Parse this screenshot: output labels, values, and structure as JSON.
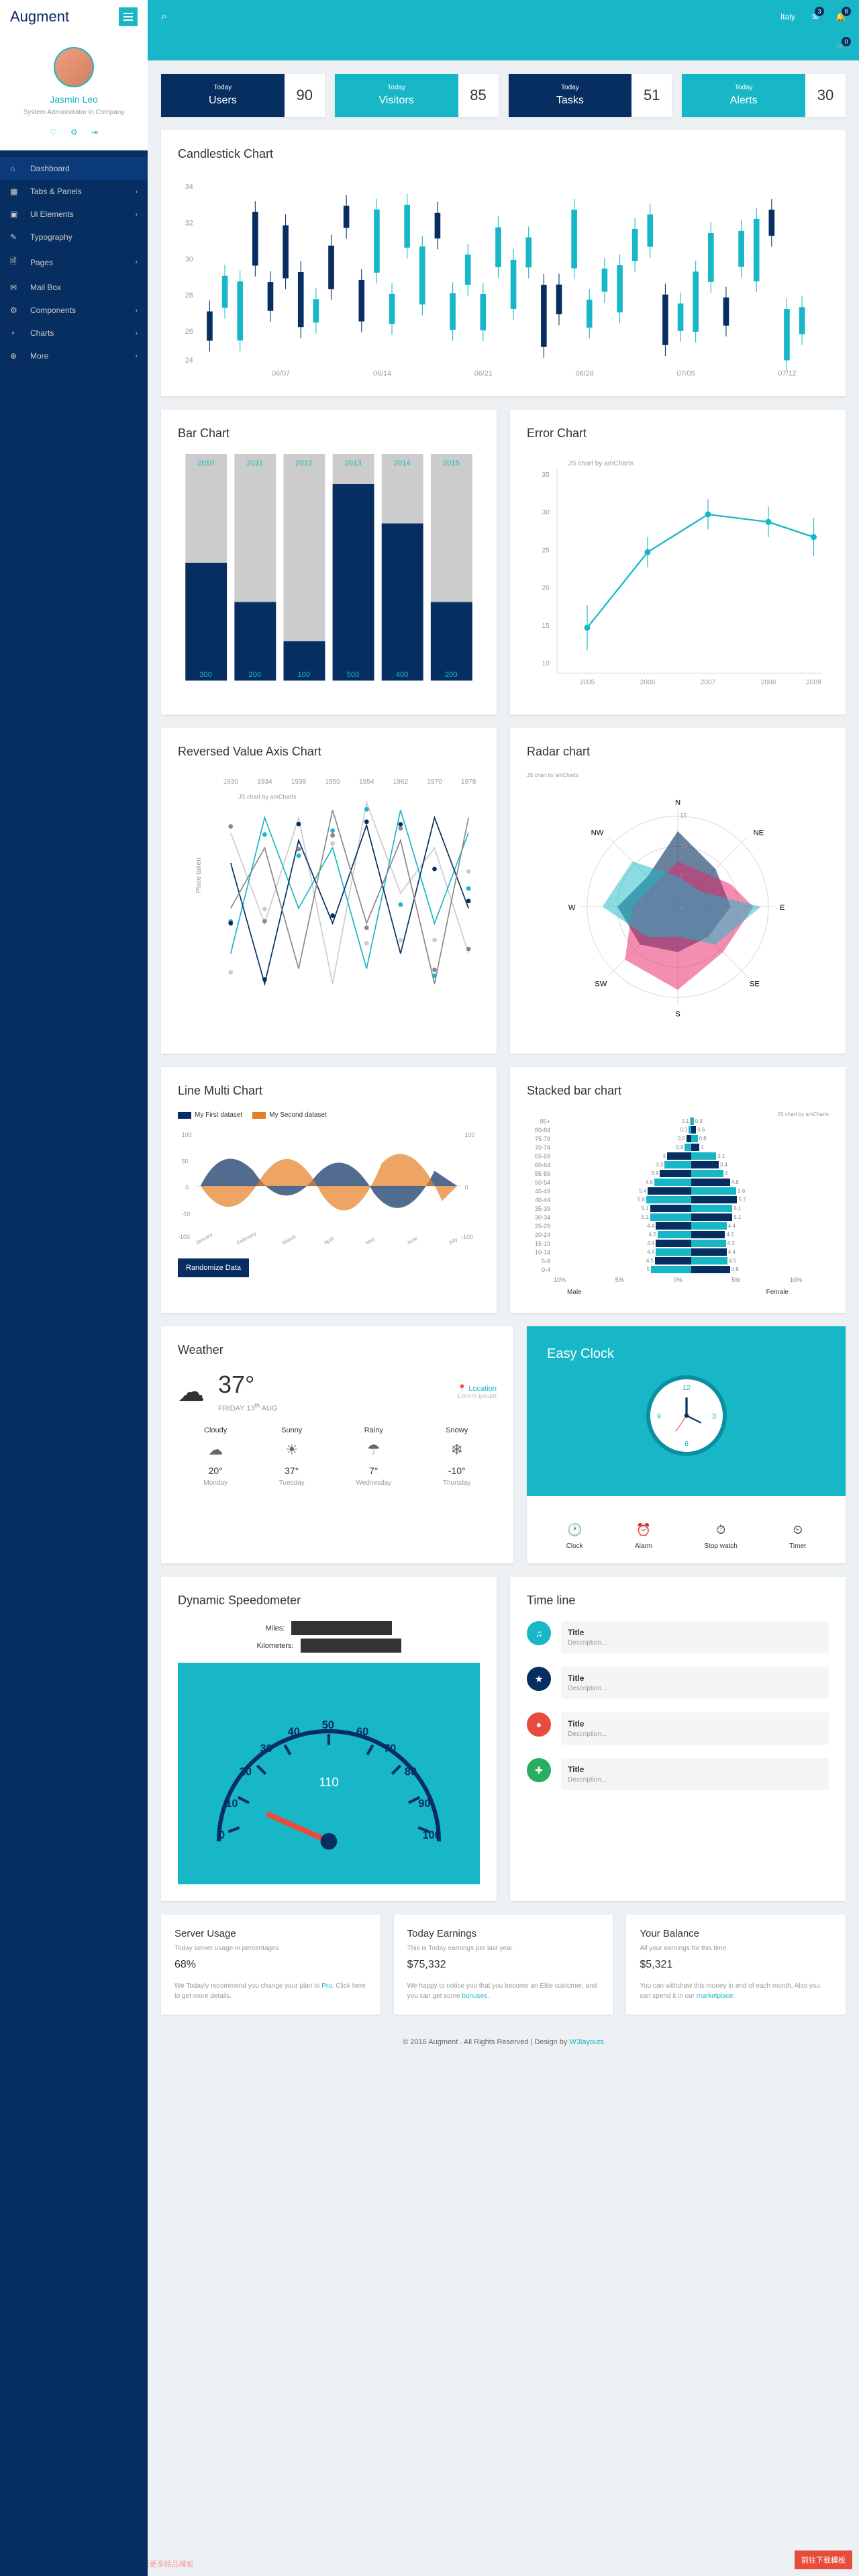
{
  "logo": "Augment",
  "profile": {
    "name": "Jasmin Leo",
    "role": "System Administrator in Company"
  },
  "nav": [
    {
      "icon": "⌂",
      "label": "Dashboard",
      "active": true
    },
    {
      "icon": "▦",
      "label": "Tabs & Panels",
      "chev": true
    },
    {
      "icon": "▣",
      "label": "Ui Elements",
      "chev": true
    },
    {
      "icon": "✎",
      "label": "Typography"
    },
    {
      "icon": "🗎",
      "label": "Pages",
      "chev": true
    },
    {
      "icon": "✉",
      "label": "Mail Box"
    },
    {
      "icon": "⚙",
      "label": "Components",
      "chev": true
    },
    {
      "icon": "◔",
      "label": "Charts",
      "chev": true
    },
    {
      "icon": "⊕",
      "label": "More",
      "chev": true
    }
  ],
  "topbar": {
    "country": "Italy",
    "msg_badge": "3",
    "bell_badge": "8",
    "cart_badge": "0"
  },
  "stats": [
    {
      "today": "Today",
      "label": "Users",
      "num": "90",
      "style": "dark"
    },
    {
      "today": "Today",
      "label": "Visitors",
      "num": "85",
      "style": "teal"
    },
    {
      "today": "Today",
      "label": "Tasks",
      "num": "51",
      "style": "dark"
    },
    {
      "today": "Today",
      "label": "Alerts",
      "num": "30",
      "style": "teal"
    }
  ],
  "titles": {
    "candlestick": "Candlestick Chart",
    "bar": "Bar Chart",
    "error": "Error Chart",
    "reversed": "Reversed Value Axis Chart",
    "radar": "Radar chart",
    "linemulti": "Line Multi Chart",
    "stacked": "Stacked bar chart",
    "weather": "Weather",
    "clock": "Easy Clock",
    "speedo": "Dynamic Speedometer",
    "timeline": "Time line",
    "server": "Server Usage",
    "earnings": "Today Earnings",
    "balance": "Your Balance"
  },
  "chart_data": {
    "candlestick": {
      "type": "candlestick",
      "x": [
        "06/07",
        "06/14",
        "06/21",
        "06/28",
        "07/05",
        "07/12"
      ],
      "ylim": [
        24,
        34
      ]
    },
    "bar": {
      "type": "bar",
      "categories": [
        "2010",
        "2011",
        "2012",
        "2013",
        "2014",
        "2015"
      ],
      "values": [
        300,
        200,
        100,
        500,
        400,
        200
      ],
      "ylim": [
        0,
        500
      ]
    },
    "error": {
      "type": "line",
      "x": [
        "2005",
        "2006",
        "2007",
        "2008",
        "2009"
      ],
      "values": [
        15,
        25,
        30,
        29,
        27
      ],
      "ylim": [
        10,
        35
      ],
      "note": "JS chart by amCharts"
    },
    "reversed": {
      "type": "line",
      "x": [
        "1930",
        "1934",
        "1938",
        "1950",
        "1954",
        "1962",
        "1970",
        "1978"
      ],
      "ylabel": "Place taken",
      "ylim": [
        1,
        6
      ],
      "series_count": 4,
      "note": "JS chart by amCharts"
    },
    "radar": {
      "type": "radar",
      "axes": [
        "N",
        "NE",
        "E",
        "SE",
        "S",
        "SW",
        "W",
        "NW"
      ],
      "rings": [
        5,
        10,
        15
      ],
      "note": "JS chart by amCharts"
    },
    "linemulti": {
      "type": "line",
      "x": [
        "January",
        "February",
        "March",
        "April",
        "May",
        "June",
        "July"
      ],
      "series": [
        {
          "name": "My First dataset",
          "color": "#072e60"
        },
        {
          "name": "My Second dataset",
          "color": "#e67e22"
        }
      ],
      "ylim_left": [
        -100,
        100
      ],
      "ylim_right": [
        -100,
        100
      ]
    },
    "stacked": {
      "type": "pyramid",
      "categories": [
        "85+",
        "80-84",
        "75-79",
        "70-74",
        "65-69",
        "60-64",
        "55-59",
        "50-54",
        "45-49",
        "40-44",
        "35-39",
        "30-34",
        "25-29",
        "20-24",
        "15-19",
        "10-14",
        "5-9",
        "0-4"
      ],
      "male": [
        0.1,
        0.3,
        0.6,
        0.8,
        3.0,
        3.3,
        3.9,
        4.6,
        5.4,
        5.6,
        5.1,
        5.1,
        4.4,
        4.2,
        4.4,
        4.4,
        4.5,
        5
      ],
      "female": [
        0.3,
        0.6,
        0.8,
        1.0,
        3.1,
        3.4,
        4.0,
        4.8,
        5.6,
        5.7,
        5.1,
        5.1,
        4.4,
        4.2,
        4.3,
        4.4,
        4.5,
        4.8
      ],
      "xlabel_left": "Male",
      "xlabel_right": "Female",
      "xticks": [
        "10%",
        "5%",
        "0%",
        "5%",
        "10%"
      ],
      "note": "JS chart by amCharts"
    }
  },
  "randomize_btn": "Randomize Data",
  "weather": {
    "temp": "37°",
    "date_day": "FRIDAY",
    "date_num": "13",
    "date_suffix": "th",
    "date_month": "AUG",
    "location": "Location",
    "location_sub": "Lorem ipsum",
    "days": [
      {
        "label": "Cloudy",
        "icon": "☁",
        "temp": "20°",
        "day": "Monday"
      },
      {
        "label": "Sunny",
        "icon": "☀",
        "temp": "37°",
        "day": "Tuesday"
      },
      {
        "label": "Rainy",
        "icon": "☂",
        "temp": "7°",
        "day": "Wednesday"
      },
      {
        "label": "Snowy",
        "icon": "❄",
        "temp": "-10°",
        "day": "Thursday"
      }
    ]
  },
  "clock_types": [
    {
      "icon": "🕐",
      "label": "Clock"
    },
    {
      "icon": "⏰",
      "label": "Alarm"
    },
    {
      "icon": "⏱",
      "label": "Stop watch"
    },
    {
      "icon": "⏲",
      "label": "Timer"
    }
  ],
  "speedo_labels": {
    "miles": "Miles:",
    "km": "Kilometers:"
  },
  "timeline": [
    {
      "color": "#17b7c8",
      "icon": "♫",
      "title": "Title",
      "desc": "Description..."
    },
    {
      "color": "#072e60",
      "icon": "★",
      "title": "Title",
      "desc": "Description..."
    },
    {
      "color": "#e74c3c",
      "icon": "●",
      "title": "Title",
      "desc": "Description..."
    },
    {
      "color": "#27ae60",
      "icon": "✚",
      "title": "Title",
      "desc": "Description..."
    }
  ],
  "bottom": {
    "server": {
      "sub": "Today server usage in percentages",
      "val": "68%",
      "desc": "We Todayly recommend you change your plan to ",
      "link": "Pro",
      "desc2": ". Click here to get more details."
    },
    "earnings": {
      "sub": "This is Today earnings per last year",
      "val": "$75,332",
      "desc": "We happy to notice you that you become an Elite customer, and you can get some ",
      "link": "bonuses",
      "desc2": "."
    },
    "balance": {
      "sub": "All your earnings for this time",
      "val": "$5,321",
      "desc": "You can withdraw this money in end of each month. Also you can spend it in our ",
      "link": "marketplace",
      "desc2": "."
    }
  },
  "footer": {
    "text": "© 2016 Augment . All Rights Reserved | Design by ",
    "link": "W3layouts"
  },
  "download": "前往下载模板",
  "watermark": "访问懒鸟飞社区bbs.lanniaofei.com免费下载更多精品模板"
}
